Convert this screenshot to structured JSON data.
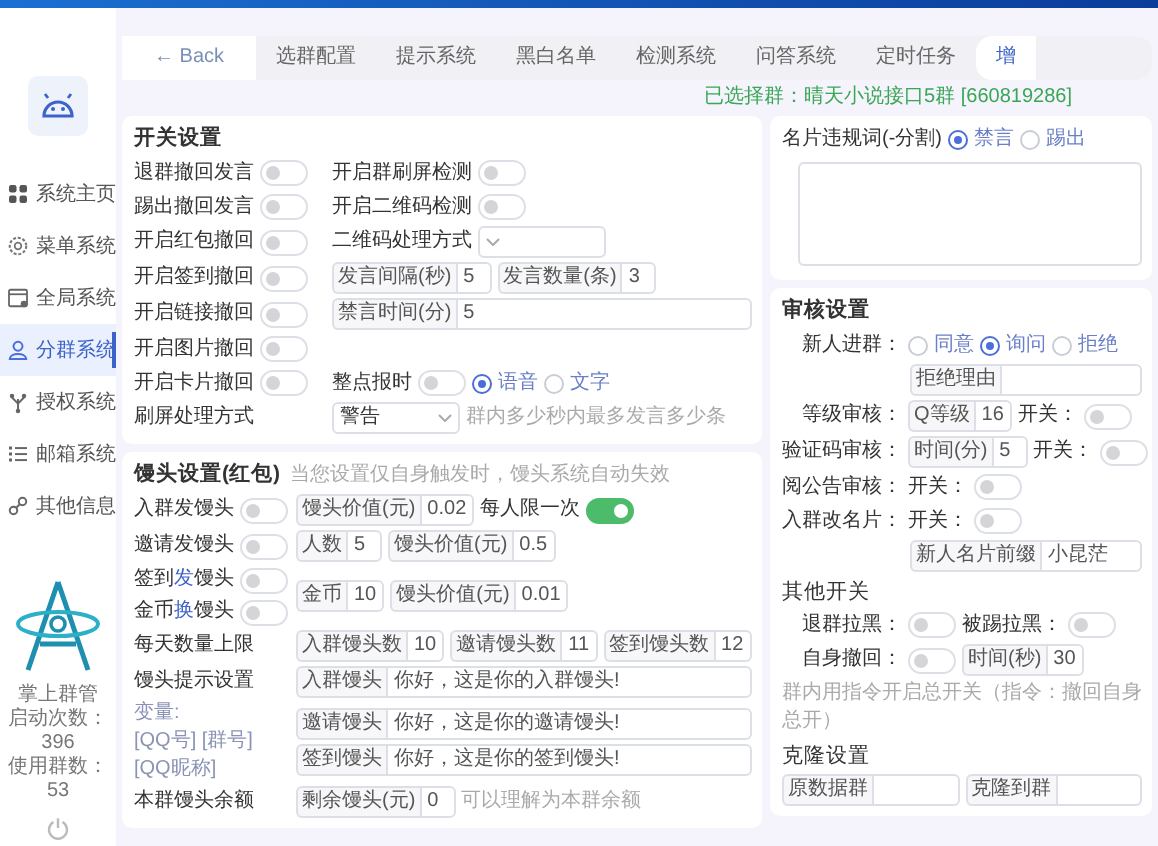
{
  "sidebar": {
    "items": [
      {
        "label": "系统主页",
        "selected": false
      },
      {
        "label": "菜单系统",
        "selected": false
      },
      {
        "label": "全局系统",
        "selected": false
      },
      {
        "label": "分群系统",
        "selected": true
      },
      {
        "label": "授权系统",
        "selected": false
      },
      {
        "label": "邮箱系统",
        "selected": false
      },
      {
        "label": "其他信息",
        "selected": false
      }
    ],
    "app_name": "掌上群管",
    "launch_count": "启动次数：396",
    "group_count": "使用群数：53"
  },
  "tabs": [
    {
      "label": "← Back",
      "kind": "back",
      "selected": false
    },
    {
      "label": "选群配置",
      "kind": "tab",
      "selected": false
    },
    {
      "label": "提示系统",
      "kind": "tab",
      "selected": false
    },
    {
      "label": "黑白名单",
      "kind": "tab",
      "selected": false
    },
    {
      "label": "检测系统",
      "kind": "tab",
      "selected": false
    },
    {
      "label": "问答系统",
      "kind": "tab",
      "selected": false
    },
    {
      "label": "定时任务",
      "kind": "tab",
      "selected": false
    },
    {
      "label": "增",
      "kind": "tab",
      "selected": true
    }
  ],
  "selected_group": "已选择群：晴天小说接口5群 [660819286]",
  "left_cards": [
    {
      "title": "开关设置",
      "rows": [
        [
          {
            "kind": "toggle",
            "label": "退群撤回发言",
            "on": false
          },
          {
            "kind": "toggle",
            "label": "开启群刷屏检测",
            "on": false
          }
        ],
        [
          {
            "kind": "toggle",
            "label": "踢出撤回发言",
            "on": false
          },
          {
            "kind": "toggle",
            "label": "开启二维码检测",
            "on": false
          }
        ],
        [
          {
            "kind": "toggle",
            "label": "开启红包撤回",
            "on": false
          },
          {
            "kind": "select",
            "label": "二维码处理方式"
          }
        ],
        [
          {
            "kind": "toggle",
            "label": "开启签到撤回",
            "on": false
          },
          {
            "kind": "input",
            "label": "发言间隔(秒)",
            "value": "5"
          },
          {
            "kind": "input",
            "label": "发言数量(条)",
            "value": "3"
          }
        ],
        [
          {
            "kind": "toggle",
            "label": "开启链接撤回",
            "on": false
          },
          {
            "kind": "wide-input",
            "label": "禁言时间(分)",
            "value": "5"
          }
        ],
        [
          {
            "kind": "toggle",
            "label": "开启图片撤回",
            "on": false
          }
        ],
        [
          {
            "kind": "toggle",
            "label": "开启卡片撤回",
            "on": false
          },
          {
            "kind": "toggle",
            "label": "整点报时",
            "on": false
          },
          {
            "kind": "radio",
            "label": "语音",
            "selected": true
          },
          {
            "kind": "radio",
            "label": "文字",
            "selected": false
          }
        ],
        [
          {
            "kind": "label",
            "text": "刷屏处理方式"
          },
          {
            "kind": "select",
            "value": "警告"
          },
          {
            "kind": "hint",
            "text": "群内多少秒内最多发言多少条"
          }
        ]
      ]
    },
    {
      "title": "馒头设置(红包)",
      "hint": "当您设置仅自身触发时，馒头系统自动失效",
      "rows": [
        [
          {
            "kind": "toggle",
            "label": "入群发馒头",
            "on": false
          },
          {
            "kind": "input",
            "label": "馒头价值(元)",
            "value": "0.02"
          },
          {
            "kind": "toggle",
            "label": "每人限一次",
            "on": true
          }
        ],
        [
          {
            "kind": "toggle",
            "label": "邀请发馒头",
            "on": false
          },
          {
            "kind": "input",
            "label": "人数",
            "value": "5"
          },
          {
            "kind": "input",
            "label": "馒头价值(元)",
            "value": "0.5"
          }
        ],
        [
          {
            "kind": "column",
            "items": [
              {
                "kind": "toggle",
                "label": "签到**发**馒头",
                "on": false
              },
              {
                "kind": "toggle",
                "label": "金币**换**馒头",
                "on": false
              }
            ]
          },
          {
            "kind": "input",
            "label": "金币",
            "value": "10"
          },
          {
            "kind": "input",
            "label": "馒头价值(元)",
            "value": "0.01"
          }
        ],
        [
          {
            "kind": "label",
            "text": "每天数量上限"
          },
          {
            "kind": "input",
            "label": "入群馒头数",
            "value": "10"
          },
          {
            "kind": "input",
            "label": "邀请馒头数",
            "value": "11"
          },
          {
            "kind": "input",
            "label": "签到馒头数",
            "value": "12"
          }
        ],
        [
          {
            "kind": "label",
            "text": "馒头提示设置"
          },
          {
            "kind": "wide-input",
            "label": "入群馒头",
            "value": "你好，这是你的入群馒头!"
          }
        ],
        [
          {
            "kind": "column",
            "items": [
              {
                "kind": "hint",
                "text": "变量:"
              },
              {
                "kind": "hint",
                "text": "[QQ号] [群号]"
              },
              {
                "kind": "hint",
                "text": "[QQ昵称]"
              }
            ]
          },
          {
            "kind": "column",
            "items": [
              {
                "kind": "wide-input",
                "label": "邀请馒头",
                "value": "你好，这是你的邀请馒头!"
              },
              {
                "kind": "wide-input",
                "label": "签到馒头",
                "value": "你好，这是你的签到馒头!"
              }
            ]
          }
        ],
        [
          {
            "kind": "label",
            "text": "本群馒头余额"
          },
          {
            "kind": "input",
            "label": "剩余馒头(元)",
            "value": "0"
          },
          {
            "kind": "hint",
            "text": "可以理解为本群余额"
          }
        ]
      ]
    }
  ],
  "right_cards": [
    {
      "rows": [
        [
          {
            "kind": "label",
            "text": "名片违规词(-分割)"
          },
          {
            "kind": "radio",
            "label": "禁言",
            "selected": true
          },
          {
            "kind": "radio",
            "label": "踢出",
            "selected": false
          }
        ],
        [
          {
            "kind": "textarea"
          }
        ]
      ]
    },
    {
      "title": "审核设置",
      "rows": [
        [
          {
            "kind": "label",
            "text": "新人进群："
          },
          {
            "kind": "radio",
            "label": "同意",
            "selected": false
          },
          {
            "kind": "radio",
            "label": "询问",
            "selected": true
          },
          {
            "kind": "radio",
            "label": "拒绝",
            "selected": false
          }
        ],
        [
          {
            "kind": "wide-input",
            "label": "拒绝理由"
          }
        ],
        [
          {
            "kind": "label",
            "text": "等级审核："
          },
          {
            "kind": "input",
            "label": "Q等级",
            "value": "16"
          },
          {
            "kind": "label",
            "text": "开关："
          },
          {
            "kind": "switch",
            "on": false
          }
        ],
        [
          {
            "kind": "label",
            "text": "验证码审核："
          },
          {
            "kind": "input",
            "label": "时间(分)",
            "value": "5"
          },
          {
            "kind": "label",
            "text": "开关："
          },
          {
            "kind": "switch",
            "on": false
          }
        ],
        [
          {
            "kind": "label",
            "text": "阅公告审核："
          },
          {
            "kind": "label",
            "text": "开关："
          },
          {
            "kind": "switch",
            "on": false
          }
        ],
        [
          {
            "kind": "label",
            "text": "入群改名片："
          },
          {
            "kind": "label",
            "text": "开关："
          },
          {
            "kind": "switch",
            "on": false
          }
        ],
        [
          {
            "kind": "wide-input",
            "label": "新人名片前缀",
            "value": "小昆茫"
          }
        ],
        [
          {
            "kind": "heading",
            "text": "其他开关"
          }
        ],
        [
          {
            "kind": "label",
            "text": "退群拉黑："
          },
          {
            "kind": "switch",
            "on": false
          },
          {
            "kind": "label",
            "text": "被踢拉黑："
          },
          {
            "kind": "switch",
            "on": false
          }
        ],
        [
          {
            "kind": "label",
            "text": "自身撤回："
          },
          {
            "kind": "switch",
            "on": false
          },
          {
            "kind": "input",
            "label": "时间(秒)",
            "value": "30"
          }
        ],
        [
          {
            "kind": "hint",
            "text": "群内用指令开启总开关（指令：撤回自身总开）"
          }
        ],
        [
          {
            "kind": "heading",
            "text": "克隆设置"
          }
        ],
        [
          {
            "kind": "wide-input",
            "label": "原数据群"
          },
          {
            "kind": "wide-input",
            "label": "克隆到群"
          }
        ]
      ]
    }
  ]
}
